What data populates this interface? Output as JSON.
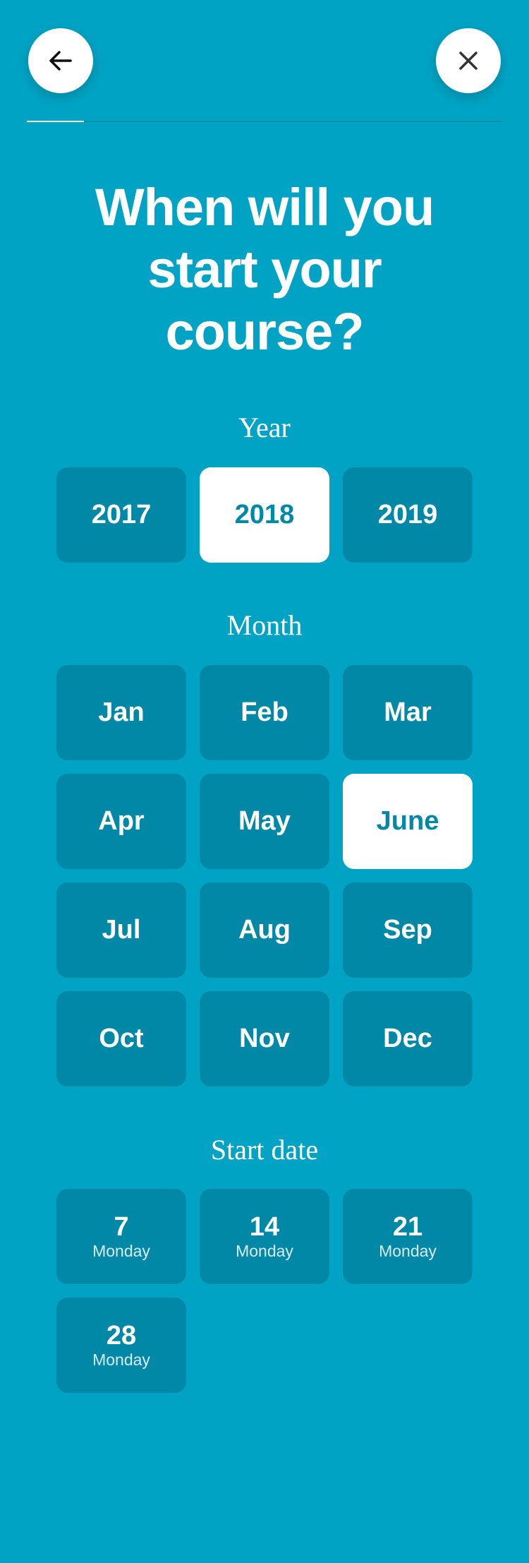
{
  "progress": 0.12,
  "nav": {
    "back_icon": "arrow-left-icon",
    "close_icon": "close-icon"
  },
  "title": {
    "line1": "When will you",
    "line2": "start your",
    "line3": "course?"
  },
  "year": {
    "label": "Year",
    "options": [
      "2017",
      "2018",
      "2019"
    ],
    "selected": "2018"
  },
  "month": {
    "label": "Month",
    "options": [
      "Jan",
      "Feb",
      "Mar",
      "Apr",
      "May",
      "June",
      "Jul",
      "Aug",
      "Sep",
      "Oct",
      "Nov",
      "Dec"
    ],
    "selected": "June"
  },
  "start_date": {
    "label": "Start date",
    "options": [
      {
        "day": "7",
        "weekday": "Monday"
      },
      {
        "day": "14",
        "weekday": "Monday"
      },
      {
        "day": "21",
        "weekday": "Monday"
      },
      {
        "day": "28",
        "weekday": "Monday"
      }
    ]
  },
  "colors": {
    "background": "#00a3c4",
    "tile": "#0088a6",
    "selected_tile": "#ffffff",
    "selected_text": "#0088a6"
  }
}
